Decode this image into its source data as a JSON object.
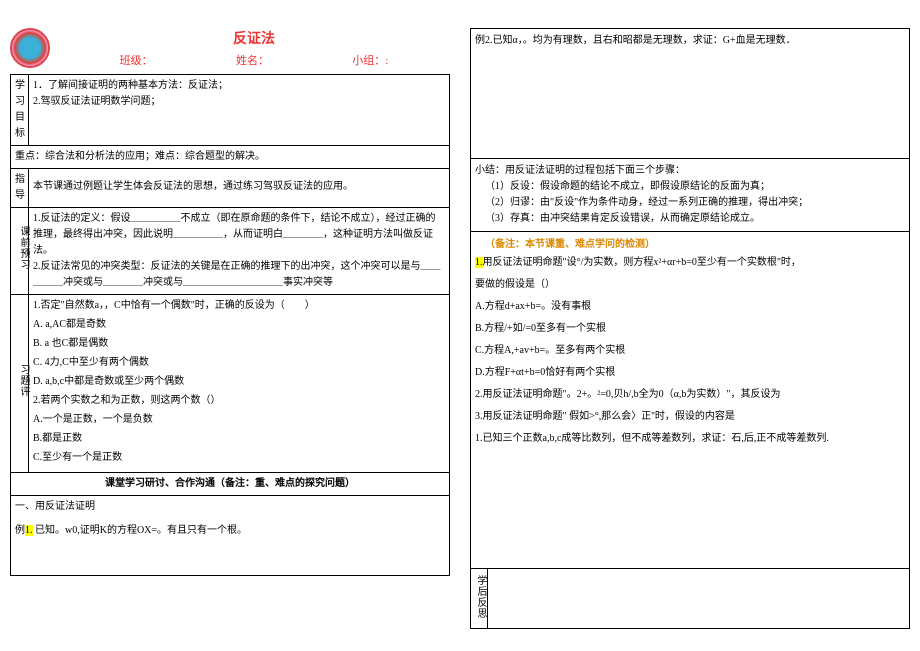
{
  "header": {
    "title": "反证法",
    "class_label": "班级：",
    "name_label": "姓名：",
    "group_label": "小组：:"
  },
  "left": {
    "row1_label": "学习目标",
    "row1_text": "1．了解间接证明的两种基本方法：反证法；\n2.驾驭反证法证明数学问题；",
    "row2_text": "重点：综合法和分析法的应用；难点：综合题型的解决。",
    "row3_label": "指导",
    "row3_text": "本节课通过例题让学生体会反证法的思想，通过练习驾驭反证法的应用。",
    "row4_label": "课前预习",
    "row4_text": "1.反证法的定义：假设＿＿＿＿＿不成立（即在原命题的条件下，结论不成立），经过正确的推理，最终得出冲突，因此说明＿＿＿＿＿，从而证明白＿＿＿＿，这种证明方法叫做反证法。\n2.反证法常见的冲突类型：反证法的关键是在正确的推理下的出冲突，这个冲突可以是与＿＿＿＿＿冲突或与＿＿＿＿冲突或与＿＿＿＿＿＿＿＿＿＿事实冲突等",
    "row5_label": "习题评",
    "q1_stem": "1.否定\"自然数a，，C中恰有一个偶数\"时，正确的反设为（　　）",
    "q1_optA": "A. a,AC都是奇数",
    "q1_optB": "B. a 也C都是偶数",
    "q1_optC": "C. 4力,C中至少有两个偶数",
    "q1_optD": "D. a,b,c中都是奇数或至少两个偶数",
    "q2_stem": "2.若两个实数之和为正数，则这两个数（）",
    "q2_optA": "A.一个是正数，一个是负数",
    "q2_optB": "B.都是正数",
    "q2_optC": "C.至少有一个是正数",
    "section_head": "课堂学习研讨、合作沟通（备注：重、难点的探究问题）",
    "sec1_title": "一、用反证法证明",
    "ex1_prefix": "例",
    "ex1_num": "1.",
    "ex1_text": "已知。w0,证明K的方程OX=。有且只有一个根。"
  },
  "right": {
    "ex2": "例2.已知α，。均为有理数，且右和昭都是无理数，求证：G+血是无理数．",
    "summary_lead": "小结：用反证法证明的过程包括下面三个步骤：",
    "summary1": "（1）反设：假设命题的结论不成立，即假设原结论的反面为真；",
    "summary2": "（2）归谬：由\"反设\"作为条件动身，经过一系列正确的推理，得出冲突；",
    "summary3": "（3）存真：由冲突结果肯定反设错误，从而确定原结论成立。",
    "check_note": "（备注：本节课重、难点学问的检测）",
    "p1_prefix": "1.",
    "p1_text": "用反证法证明命题\"设°/为实数，则方程x²+αr+b=0至少有一个实数根\"时，",
    "p1_text2": "要做的假设是（）",
    "p1_optA": "A.方程d+ax+b=。没有事根",
    "p1_optB": "B.方程/+如/=0至多有一个实根",
    "p1_optC": "C.方程A,+av+b=。至多有两个实根",
    "p1_optD": "D.方程F+αt+b=0恰好有两个实根",
    "p2": "2.用反证法证明命题\"。2+。²=0,贝h/,b全为0（α,b为实数）\"，其反设为",
    "p3": "3.用反证法证明命题\" 假如>°,那么会〉正''时，假设的内容是",
    "p4": "1.已知三个正数a,b,c成等比数列，但不成等差数列，求证：石,后,正不成等差数列.",
    "reflect_label": "学后反思"
  }
}
